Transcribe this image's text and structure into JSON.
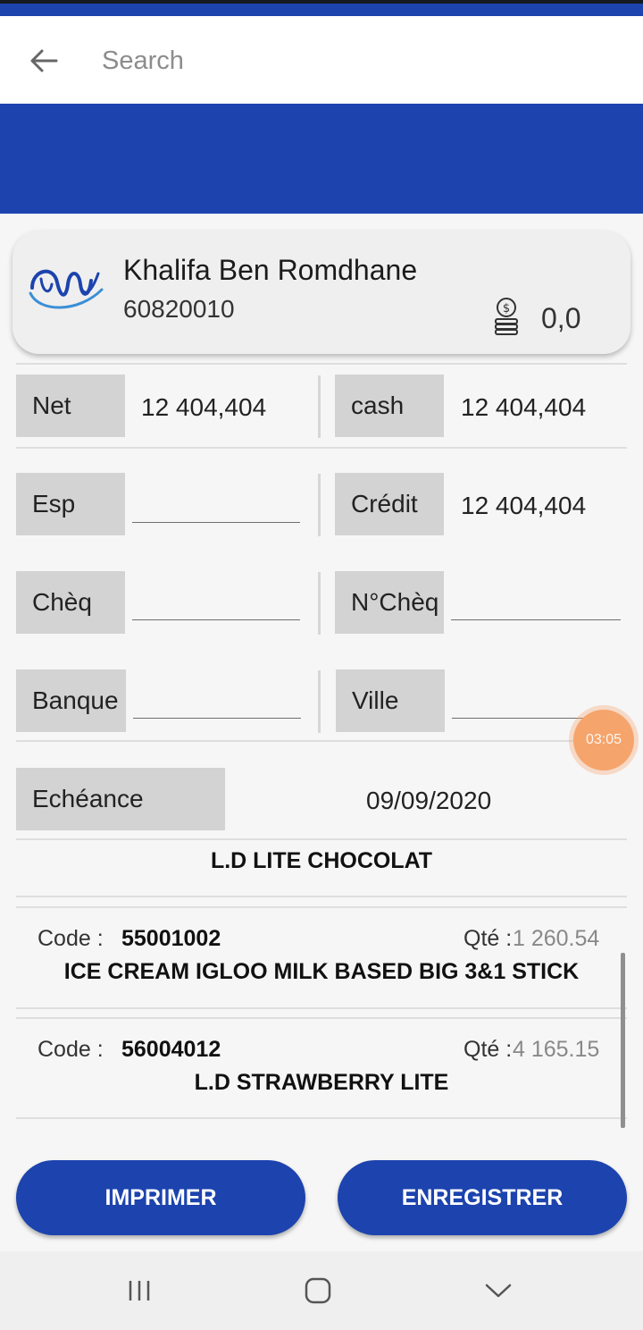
{
  "search": {
    "placeholder": "Search"
  },
  "client": {
    "name": "Khalifa Ben Romdhane",
    "code": "60820010",
    "balance": "0,0"
  },
  "payment": {
    "net_label": "Net",
    "net_value": "12 404,404",
    "cash_label": "cash",
    "cash_value": "12 404,404",
    "esp_label": "Esp",
    "esp_value": "",
    "credit_label": "Crédit",
    "credit_value": "12 404,404",
    "cheq_label": "Chèq",
    "cheq_value": "",
    "ncheq_label": "N°Chèq",
    "ncheq_value": "",
    "banque_label": "Banque",
    "banque_value": "",
    "ville_label": "Ville",
    "ville_value": "",
    "echeance_label": "Echéance",
    "echeance_value": "09/09/2020"
  },
  "timer": "03:05",
  "products": {
    "first_title": "L.D LITE CHOCOLAT",
    "items": [
      {
        "code_label": "Code :",
        "code": "55001002",
        "qty_label": "Qté :",
        "qty": "1 260.54",
        "name": "ICE CREAM IGLOO MILK BASED BIG 3&1 STICK"
      },
      {
        "code_label": "Code :",
        "code": "56004012",
        "qty_label": "Qté :",
        "qty": "4 165.15",
        "name": "L.D STRAWBERRY LITE"
      }
    ]
  },
  "actions": {
    "print_label": "IMPRIMER",
    "save_label": "ENREGISTRER"
  },
  "icons": {
    "back": "arrow-left-icon",
    "logo": "company-logo",
    "coin": "coin-stack-icon",
    "nav_recent": "recent-apps-icon",
    "nav_home": "home-icon",
    "nav_back": "chevron-down-icon"
  },
  "colors": {
    "primary": "#1c43ae",
    "label_bg": "#d3d3d3",
    "timer": "#f5a46c"
  }
}
